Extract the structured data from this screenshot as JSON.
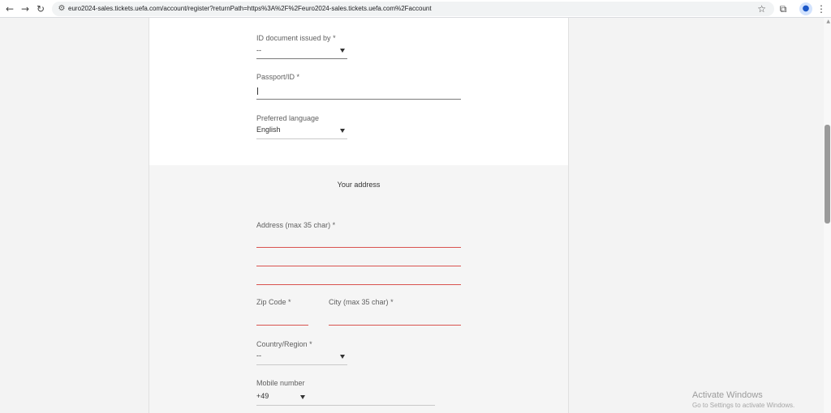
{
  "browser": {
    "url": "euro2024-sales.tickets.uefa.com/account/register?returnPath=https%3A%2F%2Feuro2024-sales.tickets.uefa.com%2Faccount",
    "back_glyph": "←",
    "forward_glyph": "→",
    "reload_glyph": "↻",
    "site_info_glyph": "⚙",
    "star_glyph": "☆",
    "extensions_glyph": "⧉",
    "profile_glyph": "●",
    "menu_glyph": "⋮"
  },
  "form": {
    "id_document_issued_by": {
      "label": "ID document issued by",
      "required_mark": "*",
      "value": "--"
    },
    "passport_id": {
      "label": "Passport/ID",
      "required_mark": "*",
      "value": ""
    },
    "preferred_language": {
      "label": "Preferred language",
      "value": "English"
    },
    "address_section": {
      "title": "Your address",
      "address": {
        "label": "Address",
        "hint": "(max 35 char)",
        "required_mark": "*"
      },
      "zip_code": {
        "label": "Zip Code",
        "required_mark": "*"
      },
      "city": {
        "label": "City",
        "hint": "(max 35 char)",
        "required_mark": "*"
      },
      "country_region": {
        "label": "Country/Region",
        "required_mark": "*",
        "value": "--"
      },
      "mobile_number": {
        "label": "Mobile number",
        "prefix": "+49"
      }
    }
  },
  "watermark": {
    "title": "Activate Windows",
    "subtitle": "Go to Settings to activate Windows."
  },
  "colors": {
    "error_underline": "#d9534f",
    "panel_top_bg": "#ffffff",
    "panel_bottom_bg": "#f5f5f5",
    "page_bg": "#f3f3f3"
  }
}
